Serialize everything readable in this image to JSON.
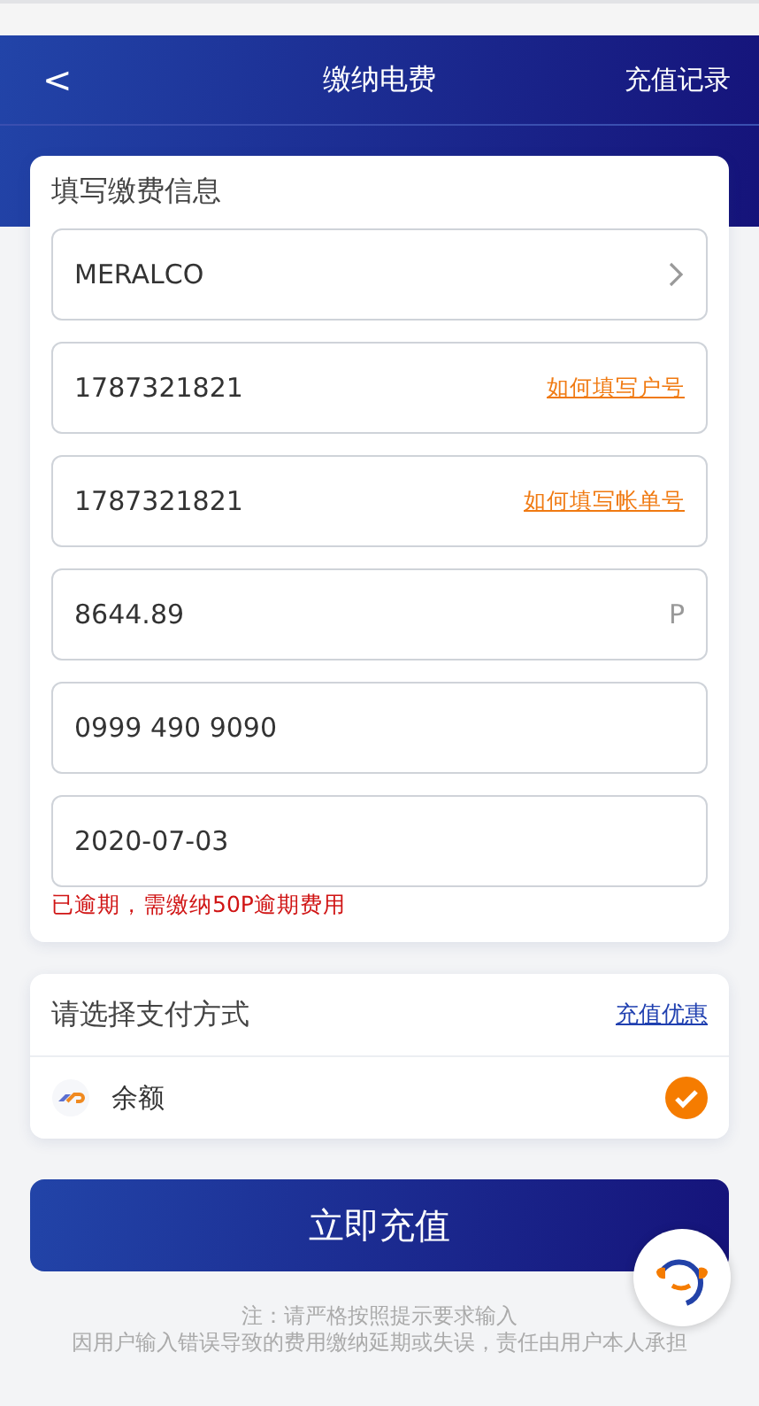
{
  "header": {
    "back": "<",
    "title": "缴纳电费",
    "action": "充值记录"
  },
  "form": {
    "title": "填写缴费信息",
    "fields": [
      {
        "kind": "select",
        "value": "MERALCO"
      },
      {
        "kind": "link",
        "value": "1787321821",
        "link": "如何填写户号"
      },
      {
        "kind": "link",
        "value": "1787321821",
        "link": "如何填写帐单号"
      },
      {
        "kind": "unit",
        "value": "8644.89",
        "unit": "P"
      },
      {
        "kind": "plain",
        "value": "0999 490 9090"
      },
      {
        "kind": "plain",
        "value": "2020-07-03"
      }
    ],
    "error": "已逾期，需缴纳50P逾期费用"
  },
  "payment": {
    "title": "请选择支付方式",
    "link": "充值优惠",
    "methods": [
      {
        "label": "余额",
        "selected": true
      }
    ]
  },
  "submit": "立即充值",
  "notes": [
    "注：请严格按照提示要求输入",
    "因用户输入错误导致的费用缴纳延期或失误，责任由用户本人承担"
  ]
}
